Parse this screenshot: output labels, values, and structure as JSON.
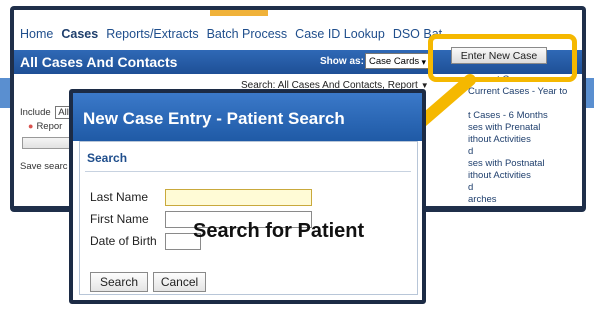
{
  "nav": {
    "items": [
      "Home",
      "Cases",
      "Reports/Extracts",
      "Batch Process",
      "Case ID Lookup",
      "DSO Bat"
    ],
    "active": "Cases"
  },
  "header": {
    "title": "All Cases And Contacts",
    "show_as_label": "Show as:",
    "show_as_value": "Case Cards"
  },
  "search_line": "Search: All Cases And Contacts, Report",
  "left_panel": {
    "include_label": "Include",
    "include_value": "All",
    "report_label": "Repor",
    "save_search": "Save searc"
  },
  "right_list": [
    "Current Cases",
    "Current Cases - Year to",
    "",
    "t Cases - 6 Months",
    "ses with Prenatal",
    "ithout Activities",
    "d",
    "ses with Postnatal",
    "ithout Activities",
    "d",
    "arches"
  ],
  "enter_new_case": "Enter New Case",
  "dialog": {
    "title": "New Case Entry - Patient Search",
    "section": "Search",
    "fields": {
      "last_name": "Last Name",
      "first_name": "First Name",
      "dob": "Date of Birth"
    },
    "annotation": "Search for Patient",
    "search_button": "Search",
    "cancel_button": "Cancel"
  },
  "colors": {
    "highlight": "#f5b800",
    "header_blue": "#1e4f96",
    "nav_blue": "#1f4e8c"
  }
}
